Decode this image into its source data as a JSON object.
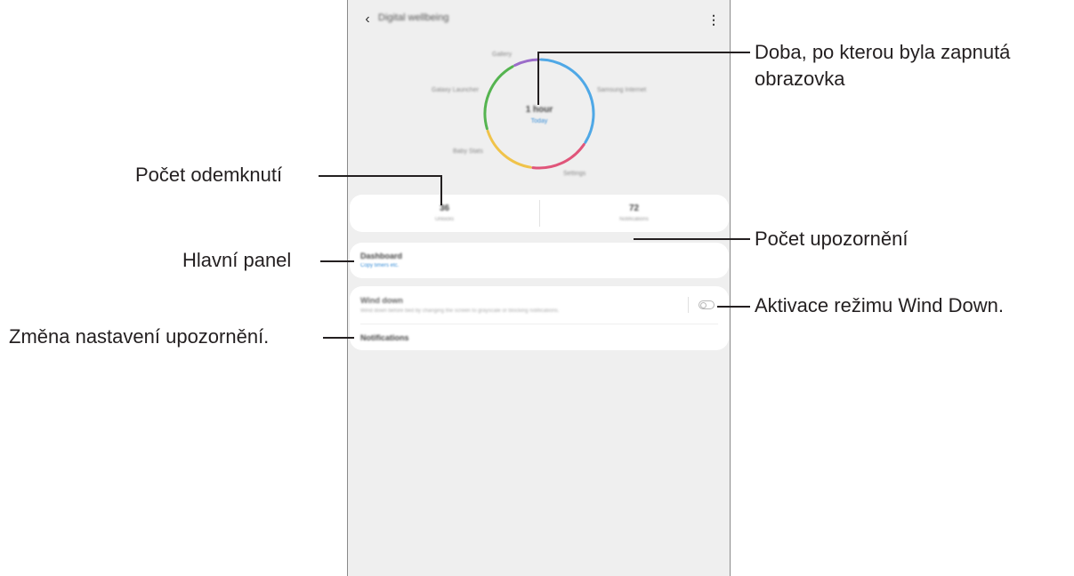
{
  "annotations": {
    "screen_time": [
      "Doba, po kterou byla zapnutá",
      "obrazovka"
    ],
    "unlocks": "Počet odemknutí",
    "notifications_count": "Počet upozornění",
    "dashboard": "Hlavní panel",
    "wind_down": "Aktivace režimu Wind Down.",
    "notification_settings": "Změna nastavení upozornění."
  },
  "screen": {
    "title": "Digital wellbeing",
    "icons": {
      "back": "chevron-left-icon",
      "more": "more-vertical-icon"
    },
    "chart_data": {
      "type": "pie",
      "center_value": "1 hour",
      "center_label": "Today",
      "slices": [
        {
          "label": "Gallery",
          "value": 8,
          "color": "#9b6cc9"
        },
        {
          "label": "Samsung Internet",
          "value": 34,
          "color": "#4fa8e6"
        },
        {
          "label": "Settings",
          "value": 18,
          "color": "#e0557a"
        },
        {
          "label": "Baby Stats",
          "value": 18,
          "color": "#f0c34a"
        },
        {
          "label": "Galaxy Launcher",
          "value": 22,
          "color": "#55b450"
        }
      ]
    },
    "stats": [
      {
        "value": "36",
        "label": "Unlocks"
      },
      {
        "value": "72",
        "label": "Notifications"
      }
    ],
    "dashboard": {
      "title": "Dashboard",
      "subtitle": "Copy timers etc."
    },
    "wind_down": {
      "title": "Wind down",
      "description": "Wind down before bed by changing the screen to grayscale or blocking notifications.",
      "enabled": false
    },
    "notifications_label": "Notifications"
  }
}
